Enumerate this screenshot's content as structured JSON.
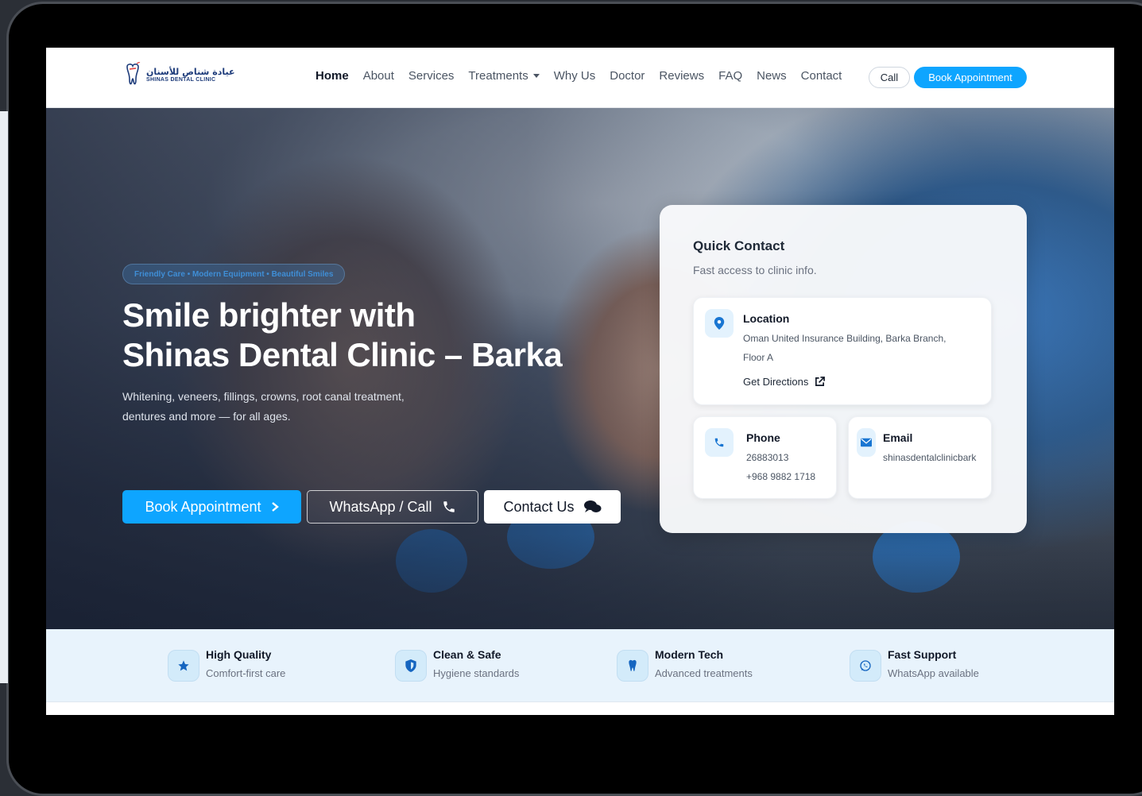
{
  "brand": {
    "name_ar": "عيادة شناص للأسنان",
    "name_en": "SHINAS DENTAL CLINIC"
  },
  "nav": {
    "items": [
      {
        "label": "Home",
        "active": true
      },
      {
        "label": "About"
      },
      {
        "label": "Services"
      },
      {
        "label": "Treatments",
        "dropdown": true
      },
      {
        "label": "Why Us"
      },
      {
        "label": "Doctor"
      },
      {
        "label": "Reviews"
      },
      {
        "label": "FAQ"
      },
      {
        "label": "News"
      },
      {
        "label": "Contact"
      }
    ],
    "call_label": "Call",
    "book_label": "Book Appointment"
  },
  "hero": {
    "tagline": "Friendly Care • Modern Equipment • Beautiful Smiles",
    "title_line1": "Smile brighter with",
    "title_line2": "Shinas Dental Clinic – Barka",
    "subtitle_line1": "Whitening, veneers, fillings, crowns, root canal treatment,",
    "subtitle_line2": "dentures and more — for all ages.",
    "btn_book": "Book Appointment",
    "btn_whatsapp": "WhatsApp / Call",
    "btn_contact": "Contact Us"
  },
  "quick_contact": {
    "title": "Quick Contact",
    "subtitle": "Fast access to clinic info.",
    "location": {
      "title": "Location",
      "line1": "Oman United Insurance Building, Barka Branch,",
      "line2": "Floor A",
      "link": "Get Directions"
    },
    "phone": {
      "title": "Phone",
      "line1": "26883013",
      "line2": "+968 9882 1718"
    },
    "email": {
      "title": "Email",
      "line1": "shinasdentalclinicbark"
    }
  },
  "features": [
    {
      "title": "High Quality",
      "subtitle": "Comfort-first care",
      "icon": "star-icon"
    },
    {
      "title": "Clean & Safe",
      "subtitle": "Hygiene standards",
      "icon": "shield-icon"
    },
    {
      "title": "Modern Tech",
      "subtitle": "Advanced treatments",
      "icon": "tooth-icon"
    },
    {
      "title": "Fast Support",
      "subtitle": "WhatsApp available",
      "icon": "whatsapp-icon"
    }
  ],
  "colors": {
    "accent": "#0ea5ff",
    "icon_blue": "#1976d2",
    "dark_text": "#111827"
  }
}
